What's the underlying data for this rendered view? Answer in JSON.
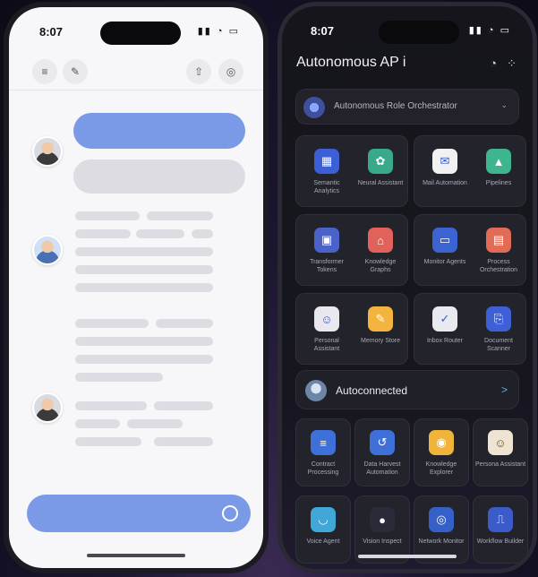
{
  "left_phone": {
    "status_time": "8:07",
    "home_indicator_color": "#4a4a52",
    "toolbar_icons": [
      "menu-icon",
      "compose-icon",
      "share-icon",
      "profile-icon"
    ],
    "accent_color": "#7a9ae8"
  },
  "right_phone": {
    "status_time": "8:07",
    "title": "Autonomous AP",
    "title_suffix": "i",
    "selector_label": "Autonomous Role Orchestrator",
    "chevron": "⌄",
    "banner_label": "Autoconnected",
    "banner_arrow": ">",
    "apps": [
      {
        "label": "Semantic Analytics",
        "color": "#3d5fd6",
        "glyph": "▦"
      },
      {
        "label": "Neural Assistant",
        "color": "#3aa88a",
        "glyph": "✿"
      },
      {
        "label": "Mail Automation",
        "color": "#f1f1f1",
        "glyph": "✉"
      },
      {
        "label": "Pipelines",
        "color": "#3fb58f",
        "glyph": "▲"
      },
      {
        "label": "Transformer Tokens",
        "color": "#4b63c9",
        "glyph": "▣"
      },
      {
        "label": "Knowledge Graphs",
        "color": "#e0625a",
        "glyph": "⌂"
      },
      {
        "label": "Monitor Agents",
        "color": "#3c63d2",
        "glyph": "▭"
      },
      {
        "label": "Process Orchestration",
        "color": "#e16b55",
        "glyph": "▤"
      },
      {
        "label": "Personal Assistant",
        "color": "#e8e8ee",
        "glyph": "☺"
      },
      {
        "label": "Memory Store",
        "color": "#f2b43c",
        "glyph": "✎"
      },
      {
        "label": "Inbox Router",
        "color": "#e9e9f0",
        "glyph": "✓"
      },
      {
        "label": "Document Scanner",
        "color": "#3f5fd6",
        "glyph": "⎘"
      }
    ],
    "tiles": [
      {
        "label": "Contract Processing",
        "color": "#3f6fd8",
        "glyph": "≡"
      },
      {
        "label": "Data Harvest Automation",
        "color": "#3f6fd8",
        "glyph": "↺"
      },
      {
        "label": "Knowledge Explorer",
        "color": "#f0b43a",
        "glyph": "◉"
      },
      {
        "label": "Persona Assistant",
        "color": "#efe3d2",
        "glyph": "☺"
      },
      {
        "label": "Voice Agent",
        "color": "#41a7d6",
        "glyph": "◡"
      },
      {
        "label": "Vision Inspect",
        "color": "#2a2a38",
        "glyph": "●"
      },
      {
        "label": "Network Monitor",
        "color": "#3560c8",
        "glyph": "◎"
      },
      {
        "label": "Workflow Builder",
        "color": "#3a5bc8",
        "glyph": "⎍"
      }
    ],
    "home_indicator_color": "#d8d8e0"
  }
}
